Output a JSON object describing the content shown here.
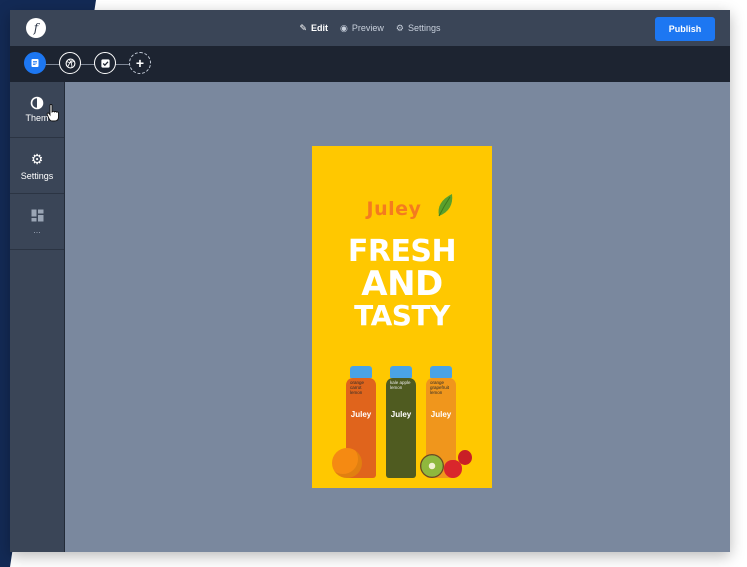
{
  "topbar": {
    "modes": [
      {
        "label": "Edit",
        "active": true
      },
      {
        "label": "Preview",
        "active": false
      },
      {
        "label": "Settings",
        "active": false
      }
    ],
    "publish_label": "Publish"
  },
  "sidebar": {
    "items": [
      {
        "label": "Them",
        "icon": "contrast-icon"
      },
      {
        "label": "Settings",
        "icon": "gear-icon"
      },
      {
        "label": "...",
        "icon": "layout-icon"
      }
    ]
  },
  "poster": {
    "brand": "Juley",
    "headline": [
      "FRESH",
      "AND",
      "TASTY"
    ],
    "bottles": [
      {
        "text": "orange carrot lemon",
        "logo": "Juley",
        "color": "#e0641c"
      },
      {
        "text": "kale apple lemon",
        "logo": "Juley",
        "color": "#4f5b20"
      },
      {
        "text": "orange grapefruit lemon",
        "logo": "Juley",
        "color": "#f0961c"
      }
    ]
  },
  "colors": {
    "accent": "#1d77f2",
    "poster_bg": "#ffc800",
    "canvas_bg": "#7a889e"
  }
}
